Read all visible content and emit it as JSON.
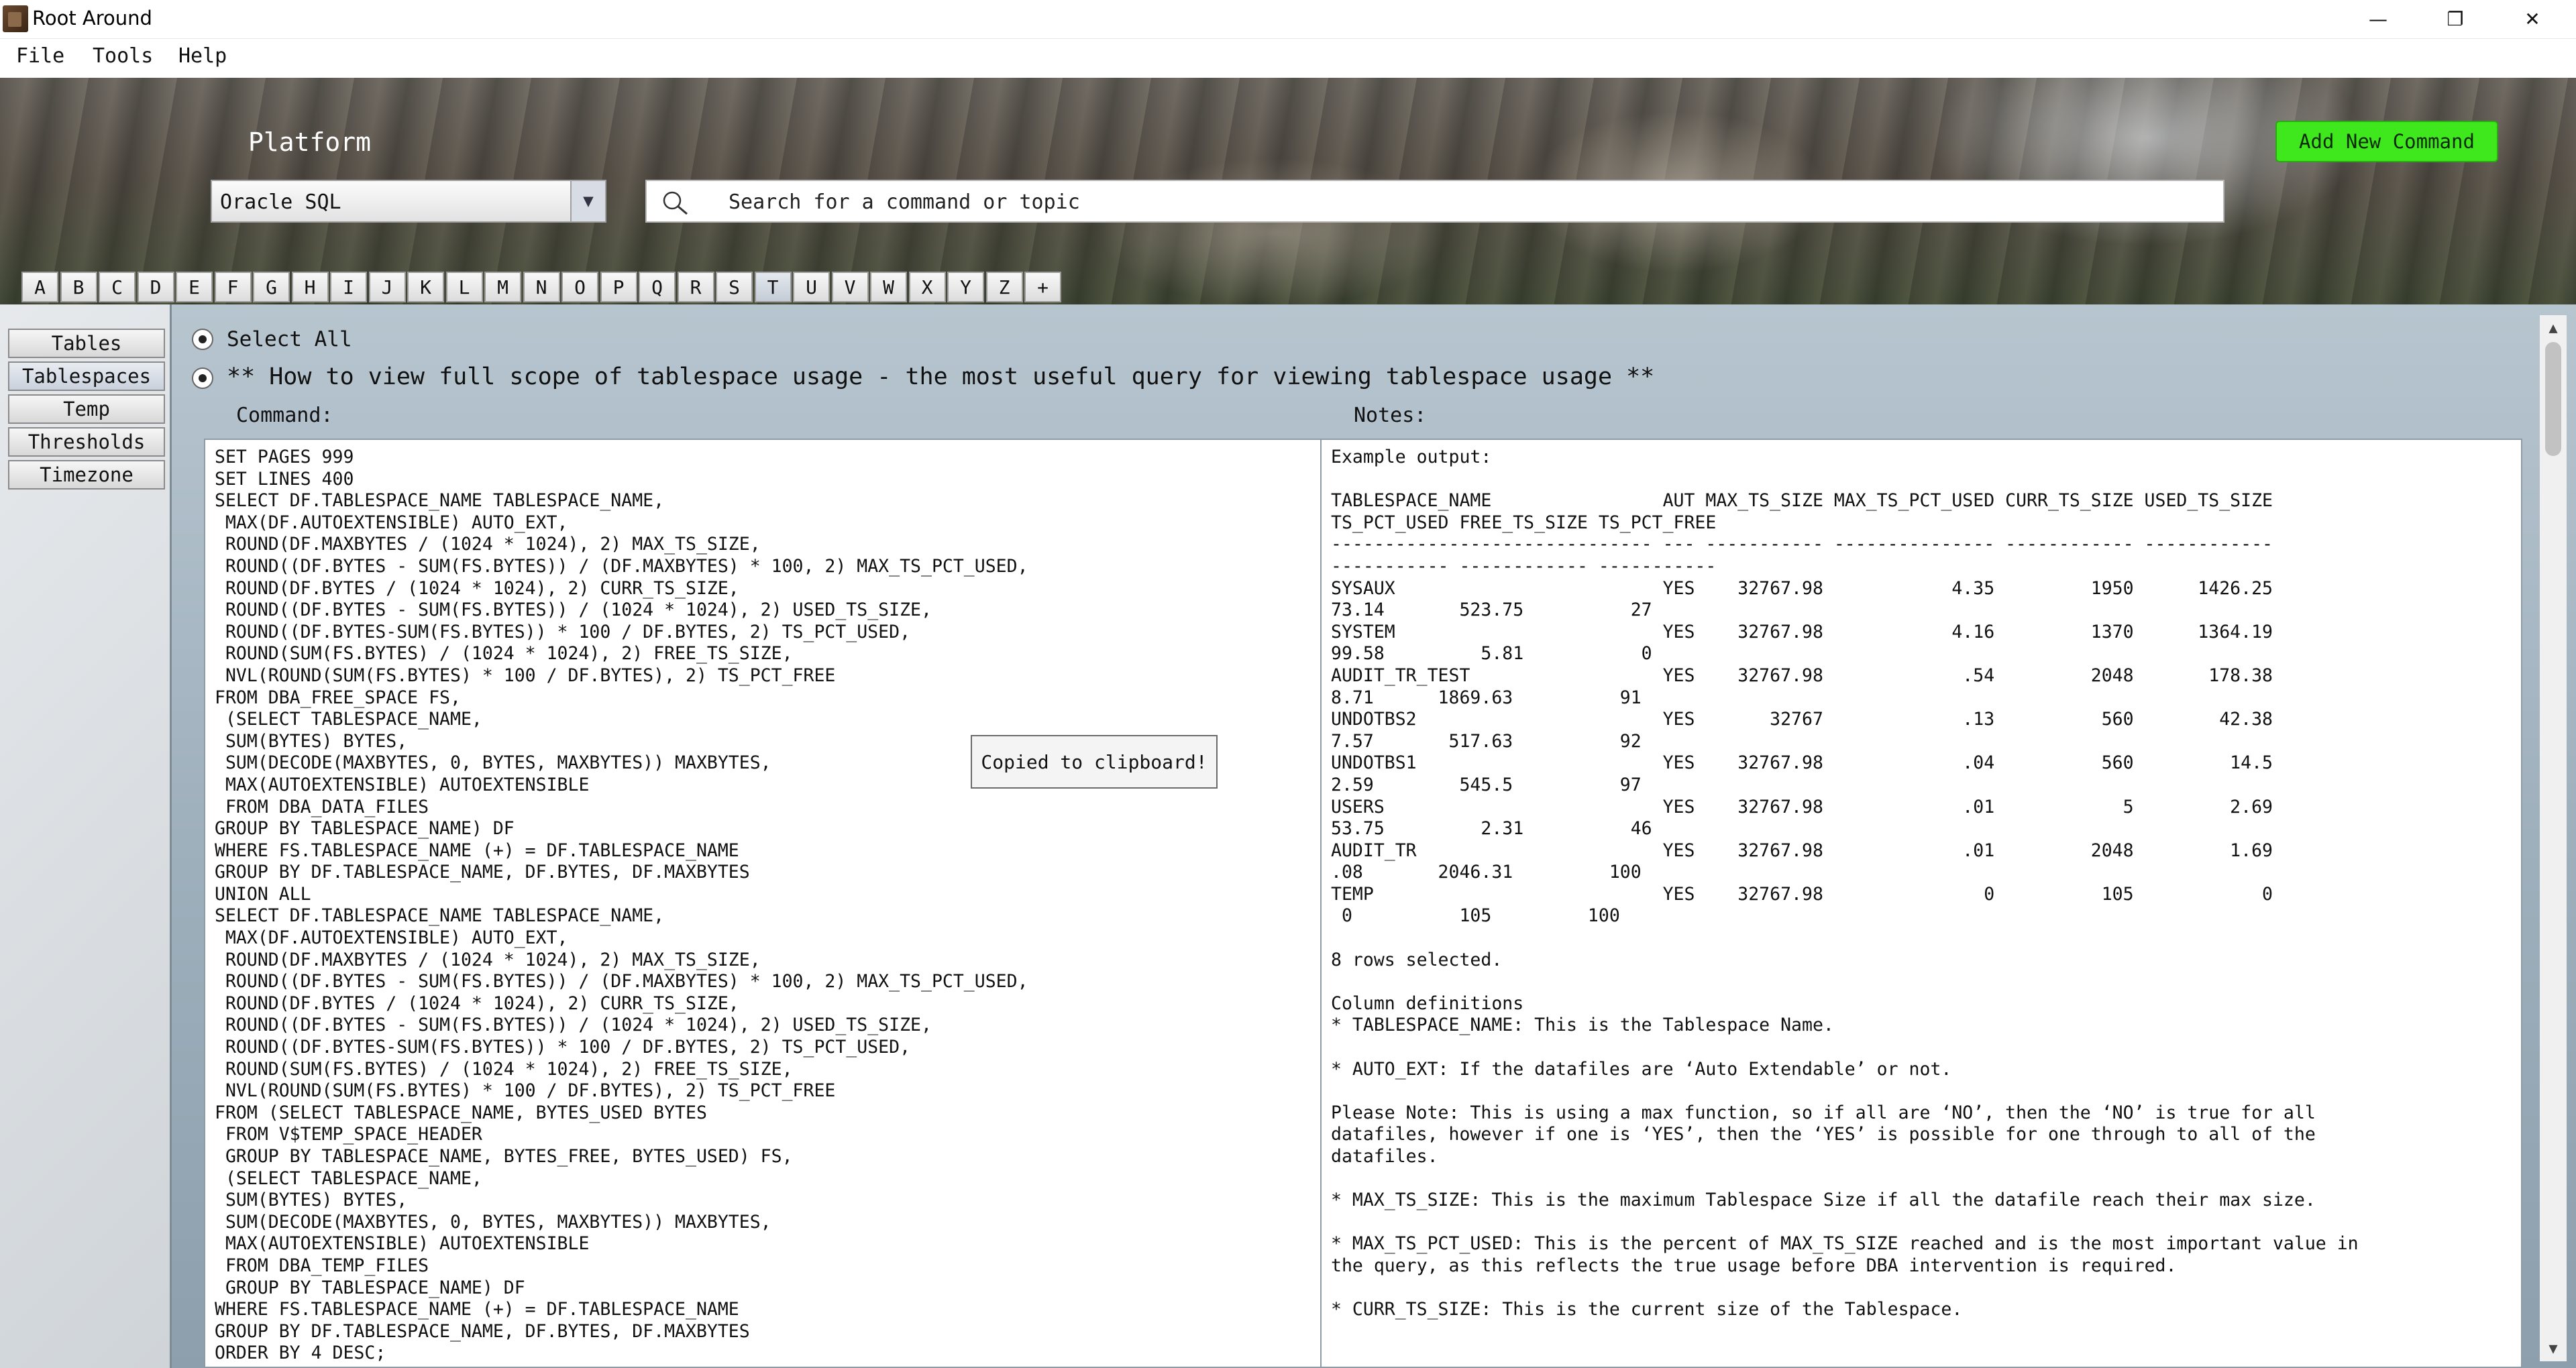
{
  "window": {
    "title": "Root Around",
    "minimize_glyph": "—",
    "restore_glyph": "❐",
    "close_glyph": "✕"
  },
  "menu": {
    "file": "File",
    "tools": "Tools",
    "help": "Help"
  },
  "header": {
    "platform_label": "Platform",
    "platform_value": "Oracle SQL",
    "search_placeholder": "Search for a command or topic",
    "add_command": "Add New Command",
    "add_color": "#3ee81d"
  },
  "letters": [
    "A",
    "B",
    "C",
    "D",
    "E",
    "F",
    "G",
    "H",
    "I",
    "J",
    "K",
    "L",
    "M",
    "N",
    "O",
    "P",
    "Q",
    "R",
    "S",
    "T",
    "U",
    "V",
    "W",
    "X",
    "Y",
    "Z",
    "+"
  ],
  "active_letter": "T",
  "sidebar": {
    "items": [
      "Tables",
      "Tablespaces",
      "Temp",
      "Thresholds",
      "Timezone"
    ],
    "active": "Tablespaces"
  },
  "content": {
    "select_all": "Select All",
    "topic_title": "** How to view full scope of tablespace usage - the most useful query for viewing tablespace usage **",
    "command_label": "Command:",
    "notes_label": "Notes:",
    "tooltip": "Copied to clipboard!",
    "command_text": "SET PAGES 999\nSET LINES 400\nSELECT DF.TABLESPACE_NAME TABLESPACE_NAME,\n MAX(DF.AUTOEXTENSIBLE) AUTO_EXT,\n ROUND(DF.MAXBYTES / (1024 * 1024), 2) MAX_TS_SIZE,\n ROUND((DF.BYTES - SUM(FS.BYTES)) / (DF.MAXBYTES) * 100, 2) MAX_TS_PCT_USED,\n ROUND(DF.BYTES / (1024 * 1024), 2) CURR_TS_SIZE,\n ROUND((DF.BYTES - SUM(FS.BYTES)) / (1024 * 1024), 2) USED_TS_SIZE,\n ROUND((DF.BYTES-SUM(FS.BYTES)) * 100 / DF.BYTES, 2) TS_PCT_USED,\n ROUND(SUM(FS.BYTES) / (1024 * 1024), 2) FREE_TS_SIZE,\n NVL(ROUND(SUM(FS.BYTES) * 100 / DF.BYTES), 2) TS_PCT_FREE\nFROM DBA_FREE_SPACE FS,\n (SELECT TABLESPACE_NAME,\n SUM(BYTES) BYTES,\n SUM(DECODE(MAXBYTES, 0, BYTES, MAXBYTES)) MAXBYTES,\n MAX(AUTOEXTENSIBLE) AUTOEXTENSIBLE\n FROM DBA_DATA_FILES\nGROUP BY TABLESPACE_NAME) DF\nWHERE FS.TABLESPACE_NAME (+) = DF.TABLESPACE_NAME\nGROUP BY DF.TABLESPACE_NAME, DF.BYTES, DF.MAXBYTES\nUNION ALL\nSELECT DF.TABLESPACE_NAME TABLESPACE_NAME,\n MAX(DF.AUTOEXTENSIBLE) AUTO_EXT,\n ROUND(DF.MAXBYTES / (1024 * 1024), 2) MAX_TS_SIZE,\n ROUND((DF.BYTES - SUM(FS.BYTES)) / (DF.MAXBYTES) * 100, 2) MAX_TS_PCT_USED,\n ROUND(DF.BYTES / (1024 * 1024), 2) CURR_TS_SIZE,\n ROUND((DF.BYTES - SUM(FS.BYTES)) / (1024 * 1024), 2) USED_TS_SIZE,\n ROUND((DF.BYTES-SUM(FS.BYTES)) * 100 / DF.BYTES, 2) TS_PCT_USED,\n ROUND(SUM(FS.BYTES) / (1024 * 1024), 2) FREE_TS_SIZE,\n NVL(ROUND(SUM(FS.BYTES) * 100 / DF.BYTES), 2) TS_PCT_FREE\nFROM (SELECT TABLESPACE_NAME, BYTES_USED BYTES\n FROM V$TEMP_SPACE_HEADER\n GROUP BY TABLESPACE_NAME, BYTES_FREE, BYTES_USED) FS,\n (SELECT TABLESPACE_NAME,\n SUM(BYTES) BYTES,\n SUM(DECODE(MAXBYTES, 0, BYTES, MAXBYTES)) MAXBYTES,\n MAX(AUTOEXTENSIBLE) AUTOEXTENSIBLE\n FROM DBA_TEMP_FILES\n GROUP BY TABLESPACE_NAME) DF\nWHERE FS.TABLESPACE_NAME (+) = DF.TABLESPACE_NAME\nGROUP BY DF.TABLESPACE_NAME, DF.BYTES, DF.MAXBYTES\nORDER BY 4 DESC;",
    "notes_text": "Example output:\n\nTABLESPACE_NAME                AUT MAX_TS_SIZE MAX_TS_PCT_USED CURR_TS_SIZE USED_TS_SIZE\nTS_PCT_USED FREE_TS_SIZE TS_PCT_FREE\n------------------------------ --- ----------- --------------- ------------ ------------\n----------- ------------ -----------\nSYSAUX                         YES    32767.98            4.35         1950      1426.25\n73.14       523.75          27\nSYSTEM                         YES    32767.98            4.16         1370      1364.19\n99.58         5.81           0\nAUDIT_TR_TEST                  YES    32767.98             .54         2048       178.38\n8.71      1869.63          91\nUNDOTBS2                       YES       32767             .13          560        42.38\n7.57       517.63          92\nUNDOTBS1                       YES    32767.98             .04          560         14.5\n2.59        545.5          97\nUSERS                          YES    32767.98             .01            5         2.69\n53.75         2.31          46\nAUDIT_TR                       YES    32767.98             .01         2048         1.69\n.08       2046.31         100\nTEMP                           YES    32767.98               0          105            0\n 0          105         100\n\n8 rows selected.\n\nColumn definitions\n* TABLESPACE_NAME: This is the Tablespace Name.\n\n* AUTO_EXT: If the datafiles are ‘Auto Extendable’ or not.\n\nPlease Note: This is using a max function, so if all are ‘NO’, then the ‘NO’ is true for all\ndatafiles, however if one is ‘YES’, then the ‘YES’ is possible for one through to all of the\ndatafiles.\n\n* MAX_TS_SIZE: This is the maximum Tablespace Size if all the datafile reach their max size.\n\n* MAX_TS_PCT_USED: This is the percent of MAX_TS_SIZE reached and is the most important value in\nthe query, as this reflects the true usage before DBA intervention is required.\n\n* CURR_TS_SIZE: This is the current size of the Tablespace."
  }
}
